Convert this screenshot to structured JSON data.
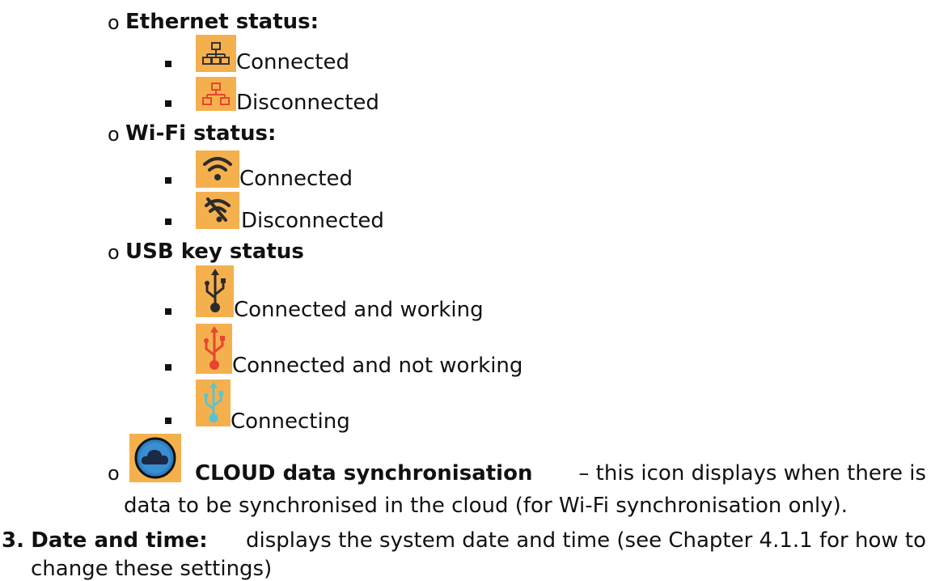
{
  "colors": {
    "icon_bg": "#f5b04e",
    "text": "#111111",
    "error": "#e8452f",
    "usb_connecting": "#59c3d3",
    "cloud": "#2e7fc2"
  },
  "ethernet": {
    "heading": "Ethernet status:",
    "items": [
      {
        "icon": "ethernet-connected-icon",
        "label": "Connected"
      },
      {
        "icon": "ethernet-disconnected-icon",
        "label": "Disconnected"
      }
    ]
  },
  "wifi": {
    "heading": "Wi-Fi status:",
    "items": [
      {
        "icon": "wifi-connected-icon",
        "label": "Connected"
      },
      {
        "icon": "wifi-disconnected-icon",
        "label": "Disconnected"
      }
    ]
  },
  "usb": {
    "heading": "USB key status",
    "items": [
      {
        "icon": "usb-working-icon",
        "label": "Connected and working"
      },
      {
        "icon": "usb-not-working-icon",
        "label": "Connected and not working"
      },
      {
        "icon": "usb-connecting-icon",
        "label": "Connecting"
      }
    ]
  },
  "cloud": {
    "icon": "cloud-sync-icon",
    "title": "CLOUD data synchronisation",
    "line1_rest": "– this icon displays when there is",
    "line2": "data to be synchronised in the cloud (for Wi-Fi synchronisation only)."
  },
  "datetime": {
    "number": "3.",
    "title": "Date and time:",
    "line1_rest": "displays the system date and time (see Chapter 4.1.1 for how to",
    "line2": "change these settings)"
  }
}
